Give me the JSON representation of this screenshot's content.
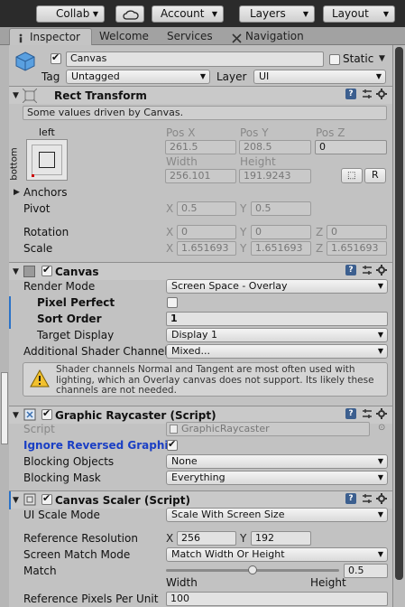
{
  "toolbar": {
    "collab": "Collab",
    "account": "Account",
    "layers": "Layers",
    "layout": "Layout"
  },
  "tabs": [
    "Inspector",
    "Welcome",
    "Services",
    "Navigation"
  ],
  "object": {
    "name": "Canvas",
    "static_label": "Static",
    "tag_label": "Tag",
    "tag_value": "Untagged",
    "layer_label": "Layer",
    "layer_value": "UI"
  },
  "rect_transform": {
    "title": "Rect Transform",
    "info": "Some values driven by Canvas.",
    "anchor_top": "left",
    "anchor_side": "bottom",
    "pos_x_label": "Pos X",
    "pos_y_label": "Pos Y",
    "pos_z_label": "Pos Z",
    "pos_x": "261.5",
    "pos_y": "208.5",
    "pos_z": "0",
    "width_label": "Width",
    "height_label": "Height",
    "width": "256.101",
    "height": "191.9243",
    "r_button": "R",
    "anchors": "Anchors",
    "pivot_label": "Pivot",
    "pivot_x": "0.5",
    "pivot_y": "0.5",
    "rotation_label": "Rotation",
    "rot_x": "0",
    "rot_y": "0",
    "rot_z": "0",
    "scale_label": "Scale",
    "scale_x": "1.651693",
    "scale_y": "1.651693",
    "scale_z": "1.651693",
    "x": "X",
    "y": "Y",
    "z": "Z"
  },
  "canvas": {
    "title": "Canvas",
    "render_mode_label": "Render Mode",
    "render_mode": "Screen Space - Overlay",
    "pixel_perfect_label": "Pixel Perfect",
    "sort_order_label": "Sort Order",
    "sort_order": "1",
    "target_display_label": "Target Display",
    "target_display": "Display 1",
    "shader_channels_label": "Additional Shader Channels",
    "shader_channels": "Mixed...",
    "warning": "Shader channels Normal and Tangent are most often used with lighting, which an Overlay canvas does not support. Its likely these channels are not needed."
  },
  "raycaster": {
    "title": "Graphic Raycaster (Script)",
    "script_label": "Script",
    "script_value": "GraphicRaycaster",
    "ignore_reversed_label": "Ignore Reversed Graphi",
    "blocking_objects_label": "Blocking Objects",
    "blocking_objects": "None",
    "blocking_mask_label": "Blocking Mask",
    "blocking_mask": "Everything"
  },
  "scaler": {
    "title": "Canvas Scaler (Script)",
    "ui_scale_mode_label": "UI Scale Mode",
    "ui_scale_mode": "Scale With Screen Size",
    "ref_res_label": "Reference Resolution",
    "ref_x": "256",
    "ref_y": "192",
    "match_mode_label": "Screen Match Mode",
    "match_mode": "Match Width Or Height",
    "match_label": "Match",
    "match_value": "0.5",
    "match_fraction": 0.5,
    "width_label": "Width",
    "height_label": "Height",
    "ref_ppu_label": "Reference Pixels Per Unit",
    "ref_ppu": "100"
  },
  "colors": {
    "toolbar_bg": "#2b2b2b",
    "panel_bg": "#c2c2c2",
    "accent_blue": "#2a72c8",
    "help_blue": "#3c5f8f"
  }
}
